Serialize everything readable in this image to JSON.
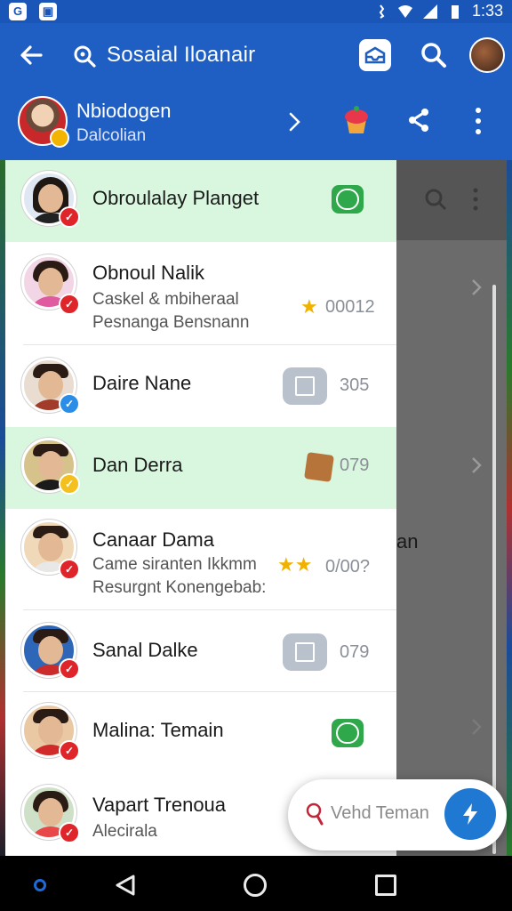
{
  "status_bar": {
    "time": "1:33"
  },
  "app_bar": {
    "title": "Sosaial Iloanair"
  },
  "profile": {
    "name": "Nbiodogen",
    "subtitle": "Dalcolian"
  },
  "contacts": [
    {
      "name": "Obroulalay Planget",
      "sub1": "",
      "sub2": "",
      "count": "",
      "action": "green",
      "highlight": true,
      "badge": "red"
    },
    {
      "name": "Obnoul Nalik",
      "sub1": "Caskel & mbiheraal",
      "sub2": "Pesnanga Bensnann",
      "count": "00012",
      "action": "star",
      "highlight": false,
      "badge": "red"
    },
    {
      "name": "Daire Nane",
      "sub1": "",
      "sub2": "",
      "count": "305",
      "action": "gray",
      "highlight": false,
      "badge": "blue"
    },
    {
      "name": "Dan Derra",
      "sub1": "",
      "sub2": "",
      "count": "079",
      "action": "cookie",
      "highlight": true,
      "badge": "yellow"
    },
    {
      "name": "Canaar Dama",
      "sub1": "Came siranten Ikkmm",
      "sub2": "Resurgnt Konengebab:",
      "count": "0/00?",
      "action": "stars",
      "highlight": false,
      "badge": "red"
    },
    {
      "name": "Sanal Dalke",
      "sub1": "",
      "sub2": "",
      "count": "079",
      "action": "gray",
      "highlight": false,
      "badge": "red"
    },
    {
      "name": "Malina: Temain",
      "sub1": "",
      "sub2": "",
      "count": "",
      "action": "green",
      "highlight": false,
      "badge": "red"
    },
    {
      "name": "Vapart Trenoua",
      "sub1": "Alecirala",
      "sub2": "",
      "count": "",
      "action": "",
      "highlight": false,
      "badge": "red"
    }
  ],
  "background": {
    "partial_text": "an"
  },
  "search_pill": {
    "placeholder": "Vehd Teman"
  },
  "colors": {
    "primary": "#1f5fc4",
    "highlight_row": "#d9f7df",
    "fab": "#1f78d1",
    "badge_red": "#e0252a"
  }
}
